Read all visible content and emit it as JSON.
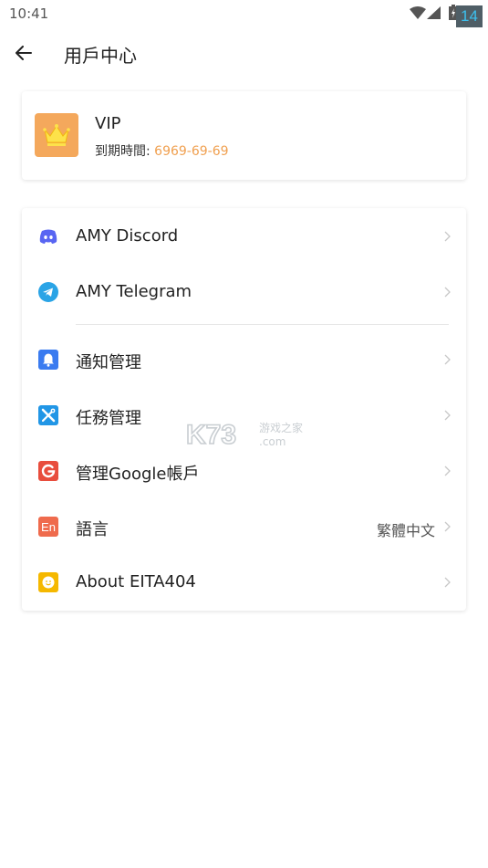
{
  "status_bar": {
    "time": "10:41",
    "watermark_badge": "14"
  },
  "header": {
    "title": "用戶中心"
  },
  "vip_card": {
    "name": "VIP",
    "expire_label": "到期時間: ",
    "expire_value": "6969-69-69"
  },
  "menu": {
    "items": [
      {
        "label": "AMY Discord",
        "icon": "discord-icon",
        "value": ""
      },
      {
        "label": "AMY Telegram",
        "icon": "telegram-icon",
        "value": ""
      },
      {
        "label": "通知管理",
        "icon": "bell-icon",
        "value": ""
      },
      {
        "label": "任務管理",
        "icon": "tools-icon",
        "value": ""
      },
      {
        "label": "管理Google帳戶",
        "icon": "google-icon",
        "value": ""
      },
      {
        "label": "語言",
        "icon": "language-icon",
        "value": "繁體中文"
      },
      {
        "label": "About EITA404",
        "icon": "smiley-icon",
        "value": ""
      }
    ]
  },
  "watermark": {
    "main": "K73",
    "sub_top": "游戏之家",
    "sub_bottom": ".com"
  },
  "colors": {
    "accent_orange": "#f0a050",
    "discord": "#5865f2",
    "telegram": "#2aa4e6",
    "bell": "#3a7bf0",
    "tools": "#2196e6",
    "google": "#e84d3d",
    "language": "#ef6b4d",
    "smiley": "#f5b800"
  }
}
